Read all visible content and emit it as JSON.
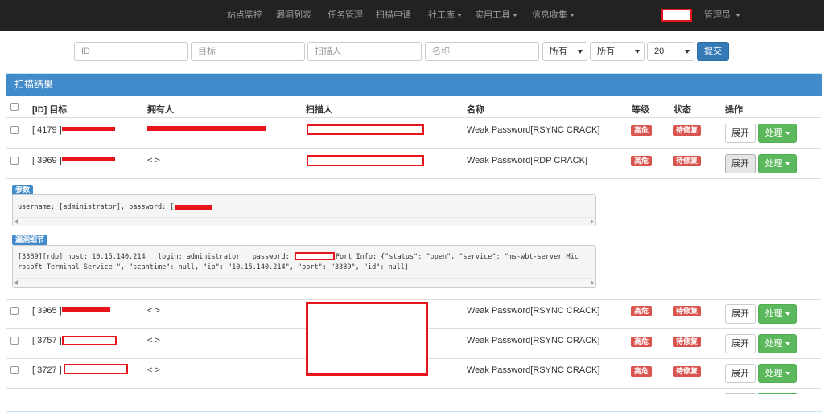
{
  "navbar": {
    "items": [
      {
        "label": "站点监控",
        "dropdown": false
      },
      {
        "label": "漏洞列表",
        "dropdown": false
      },
      {
        "label": "任务管理",
        "dropdown": false
      },
      {
        "label": "扫描申请",
        "dropdown": false
      },
      {
        "label": "社工库",
        "dropdown": true
      },
      {
        "label": "实用工具",
        "dropdown": true
      },
      {
        "label": "信息收集",
        "dropdown": true
      }
    ],
    "user": "管理员"
  },
  "filters": {
    "id_placeholder": "ID",
    "target_placeholder": "目标",
    "scanner_placeholder": "扫描人",
    "name_placeholder": "名称",
    "select1": "所有",
    "select2": "所有",
    "select3": "20",
    "submit": "提交"
  },
  "panel": {
    "title": "扫描结果",
    "columns": {
      "target": "[ID] 目标",
      "owner": "拥有人",
      "scanner": "扫描人",
      "name": "名称",
      "level": "等级",
      "status": "状态",
      "action": "操作"
    }
  },
  "rows": [
    {
      "id": "[ 4179 ]",
      "owner": "",
      "name": "Weak Password[RSYNC CRACK]",
      "level": "高危",
      "status": "待修复",
      "open": "展开",
      "action": "处理"
    },
    {
      "id": "[ 3969 ]",
      "owner": "< >",
      "name": "Weak Password[RDP CRACK]",
      "level": "高危",
      "status": "待修复",
      "open": "展开",
      "action": "处理"
    },
    {
      "id": "[ 3965 ]",
      "owner": "< >",
      "name": "Weak Password[RSYNC CRACK]",
      "level": "高危",
      "status": "待修复",
      "open": "展开",
      "action": "处理"
    },
    {
      "id": "[ 3757 ]",
      "owner": "< >",
      "name": "Weak Password[RSYNC CRACK]",
      "level": "高危",
      "status": "待修复",
      "open": "展开",
      "action": "处理"
    },
    {
      "id": "[ 3727 ]",
      "owner": "< >",
      "name": "Weak Password[RSYNC CRACK]",
      "level": "高危",
      "status": "待修复",
      "open": "展开",
      "action": "处理"
    }
  ],
  "detail": {
    "params_label": "参数",
    "params_text": "username: [administrator], password: [",
    "vuln_label": "漏洞细节",
    "vuln_line1_a": "[3389][rdp] host: 10.15.140.214   login: administrator   password:",
    "vuln_line1_b": " Port Info: {\"status\": \"open\", \"service\": \"ms-wbt-server Mic",
    "vuln_line2": "rosoft Terminal Service \", \"scantime\": null, \"ip\": \"10.15.140.214\", \"port\": \"3389\", \"id\": null}"
  },
  "colors": {
    "navbar": "#222222",
    "panel_heading": "#428bca",
    "danger": "#d9534f",
    "success": "#5cb85c",
    "primary": "#337ab7",
    "redaction": "#e8141b"
  }
}
